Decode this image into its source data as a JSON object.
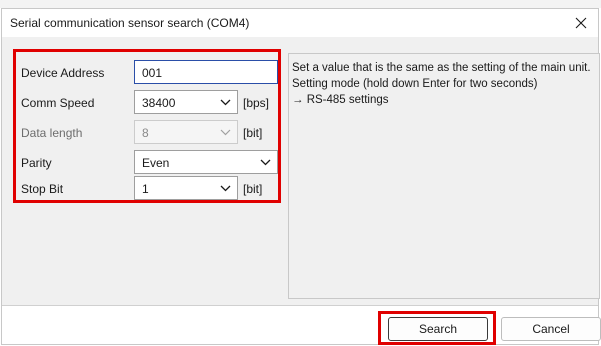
{
  "background": {
    "partial_text": "..."
  },
  "dialog": {
    "title": "Serial communication sensor search (COM4)",
    "close_icon": "close-icon"
  },
  "params": {
    "device_address": {
      "label": "Device Address",
      "value": "001"
    },
    "comm_speed": {
      "label": "Comm Speed",
      "value": "38400",
      "unit": "[bps]"
    },
    "data_length": {
      "label": "Data length",
      "value": "8",
      "unit": "[bit]",
      "disabled": true
    },
    "parity": {
      "label": "Parity",
      "value": "Even"
    },
    "stop_bit": {
      "label": "Stop Bit",
      "value": "1",
      "unit": "[bit]"
    }
  },
  "info": {
    "line1": "Set a value that is the same as the setting of the main unit.",
    "line2": "Setting mode (hold down Enter for two seconds)",
    "line3": "→ RS-485 settings"
  },
  "buttons": {
    "search": "Search",
    "cancel": "Cancel"
  },
  "colors": {
    "highlight": "#e00000",
    "focus_border": "#2a4ea8",
    "panel_bg": "#f0f0f0"
  }
}
